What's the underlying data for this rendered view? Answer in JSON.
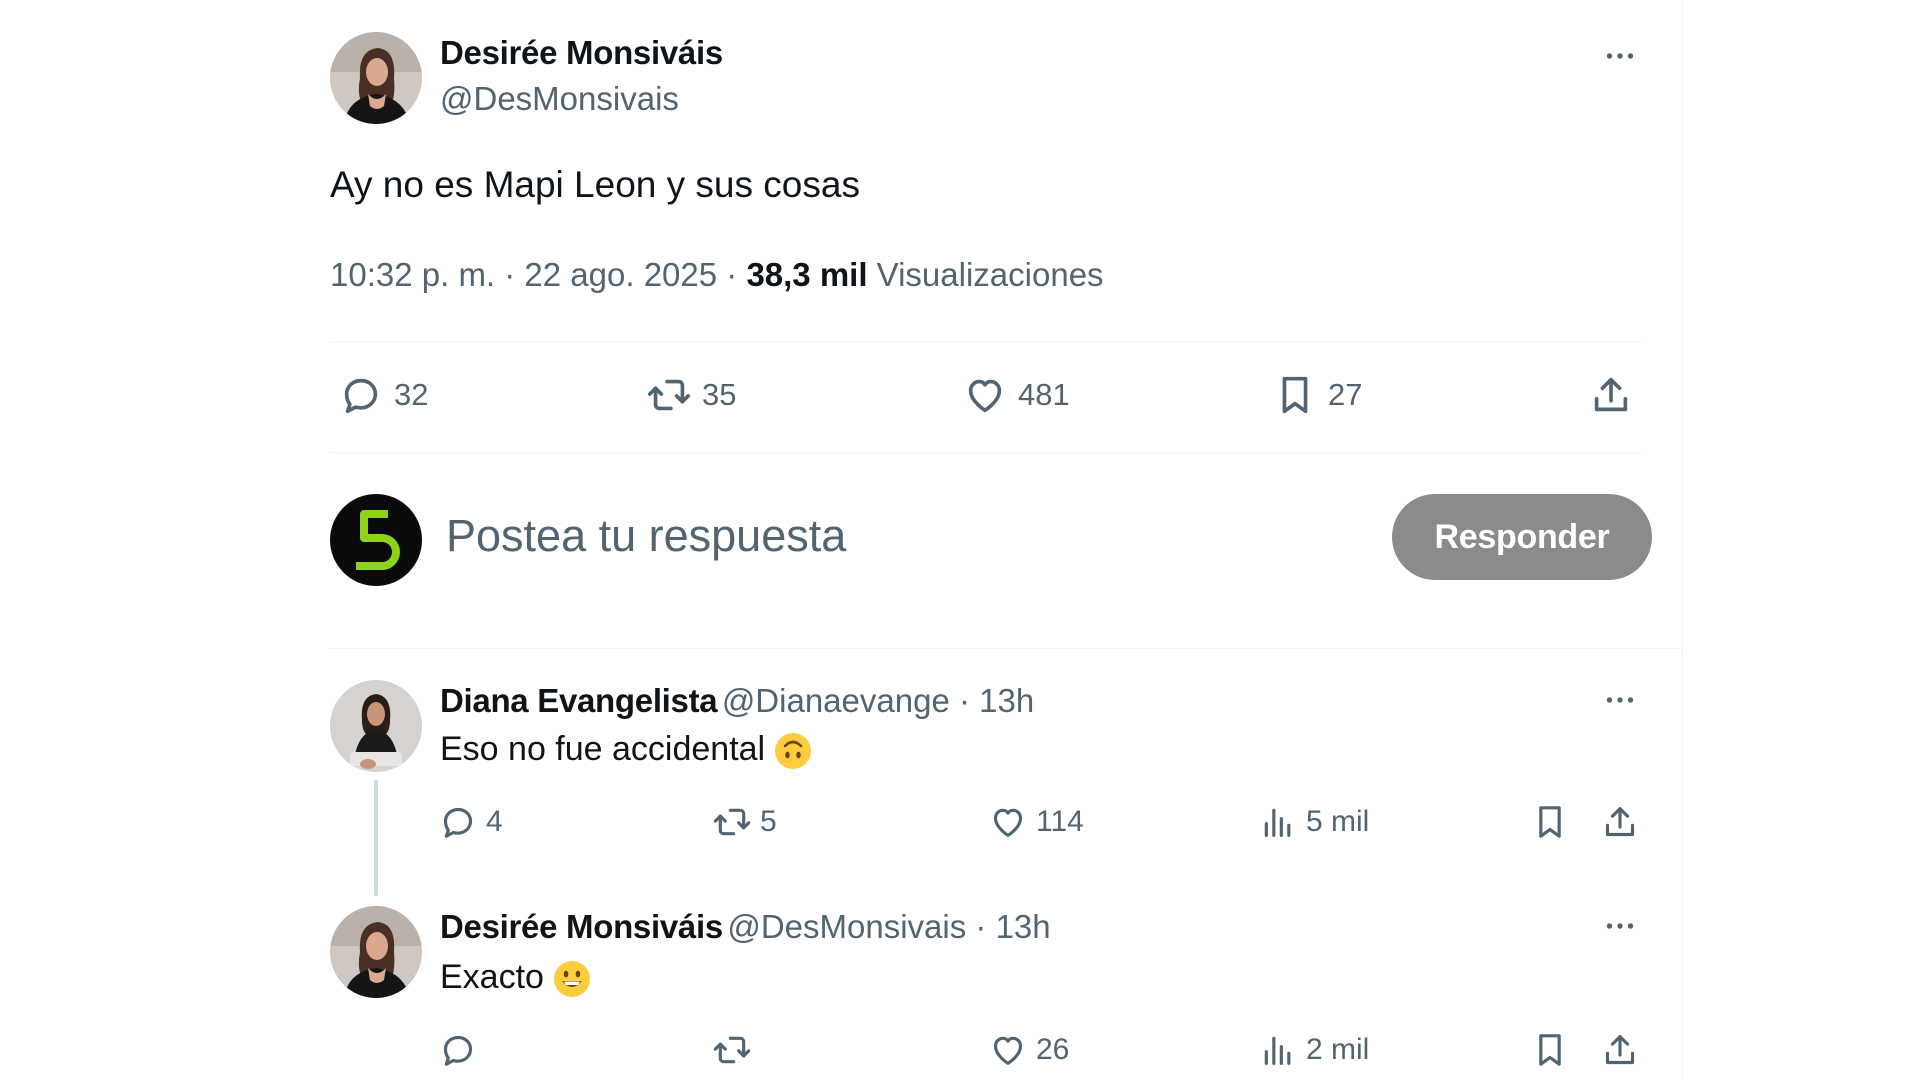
{
  "main_post": {
    "author_name": "Desirée Monsiváis",
    "author_handle": "@DesMonsivais",
    "text": "Ay no es Mapi Leon y sus cosas",
    "time": "10:32 p. m. · 22 ago. 2025 · ",
    "views_count": "38,3 mil",
    "views_label": " Visualizaciones",
    "actions": {
      "replies": "32",
      "reposts": "35",
      "likes": "481",
      "bookmarks": "27"
    }
  },
  "composer": {
    "placeholder": "Postea tu respuesta",
    "button_label": "Responder"
  },
  "replies": [
    {
      "author_name": "Diana Evangelista",
      "author_handle": "@Dianaevange · 13h",
      "text": "Eso no fue accidental",
      "emoji": "upside-down-face",
      "replies": "4",
      "reposts": "5",
      "likes": "114",
      "views": "5 mil"
    },
    {
      "author_name": "Desirée Monsiváis",
      "author_handle": "@DesMonsivais · 13h",
      "text": "Exacto",
      "emoji": "grinning-face",
      "replies": "",
      "reposts": "",
      "likes": "26",
      "views": "2 mil"
    }
  ],
  "colors": {
    "muted": "#536471",
    "button_disabled": "#8b8b8b",
    "brand_green": "#8ed11f"
  }
}
